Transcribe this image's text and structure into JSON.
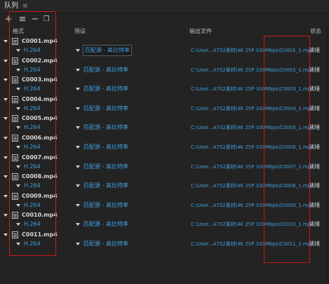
{
  "panel": {
    "title": "队列",
    "menu_icon": "hamburger-icon"
  },
  "toolbar": {
    "buttons": [
      {
        "name": "add",
        "glyph": "+"
      },
      {
        "name": "settings",
        "glyph": "≡"
      },
      {
        "name": "remove",
        "glyph": "−"
      },
      {
        "name": "duplicate",
        "glyph": "❐"
      }
    ]
  },
  "columns": {
    "format": "格式",
    "preset": "预设",
    "output": "输出文件",
    "status": "状态"
  },
  "items": [
    {
      "file": "C0001.mp4",
      "format": "H.264",
      "preset": "匹配源 - 高比特率",
      "output": "C:\\User...A7S2素材\\4K 25P 100Mbps\\C0001_1.mp4",
      "status": "就绪"
    },
    {
      "file": "C0002.mp4",
      "format": "H.264",
      "preset": "匹配源 - 高比特率",
      "output": "C:\\User...A7S2素材\\4K 25P 100Mbps\\C0002_1.mp4",
      "status": "就绪"
    },
    {
      "file": "C0003.mp4",
      "format": "H.264",
      "preset": "匹配源 - 高比特率",
      "output": "C:\\User...A7S2素材\\4K 25P 100Mbps\\C0003_1.mp4",
      "status": "就绪"
    },
    {
      "file": "C0004.mp4",
      "format": "H.264",
      "preset": "匹配源 - 高比特率",
      "output": "C:\\User...A7S2素材\\4K 25P 100Mbps\\C0004_1.mp4",
      "status": "就绪"
    },
    {
      "file": "C0005.mp4",
      "format": "H.264",
      "preset": "匹配源 - 高比特率",
      "output": "C:\\User...A7S2素材\\4K 25P 100Mbps\\C0005_1.mp4",
      "status": "就绪"
    },
    {
      "file": "C0006.mp4",
      "format": "H.264",
      "preset": "匹配源 - 高比特率",
      "output": "C:\\User...A7S2素材\\4K 25P 100Mbps\\C0006_1.mp4",
      "status": "就绪"
    },
    {
      "file": "C0007.mp4",
      "format": "H.264",
      "preset": "匹配源 - 高比特率",
      "output": "C:\\User...A7S2素材\\4K 25P 100Mbps\\C0007_1.mp4",
      "status": "就绪"
    },
    {
      "file": "C0008.mp4",
      "format": "H.264",
      "preset": "匹配源 - 高比特率",
      "output": "C:\\User...A7S2素材\\4K 25P 100Mbps\\C0008_1.mp4",
      "status": "就绪"
    },
    {
      "file": "C0009.mp4",
      "format": "H.264",
      "preset": "匹配源 - 高比特率",
      "output": "C:\\User...A7S2素材\\4K 25P 100Mbps\\C0009_1.mp4",
      "status": "就绪"
    },
    {
      "file": "C0010.mp4",
      "format": "H.264",
      "preset": "匹配源 - 高比特率",
      "output": "C:\\User...A7S2素材\\4K 25P 100Mbps\\C0010_1.mp4",
      "status": "就绪"
    },
    {
      "file": "C0011.mp4",
      "format": "H.264",
      "preset": "匹配源 - 高比特率",
      "output": "C:\\User...A7S2素材\\4K 25P 100Mbps\\C0011_1.mp4",
      "status": "就绪"
    }
  ],
  "selected_preset_index": 0,
  "colors": {
    "link": "#3f9fe0",
    "highlight_box": "#d01818",
    "background": "#232323"
  }
}
